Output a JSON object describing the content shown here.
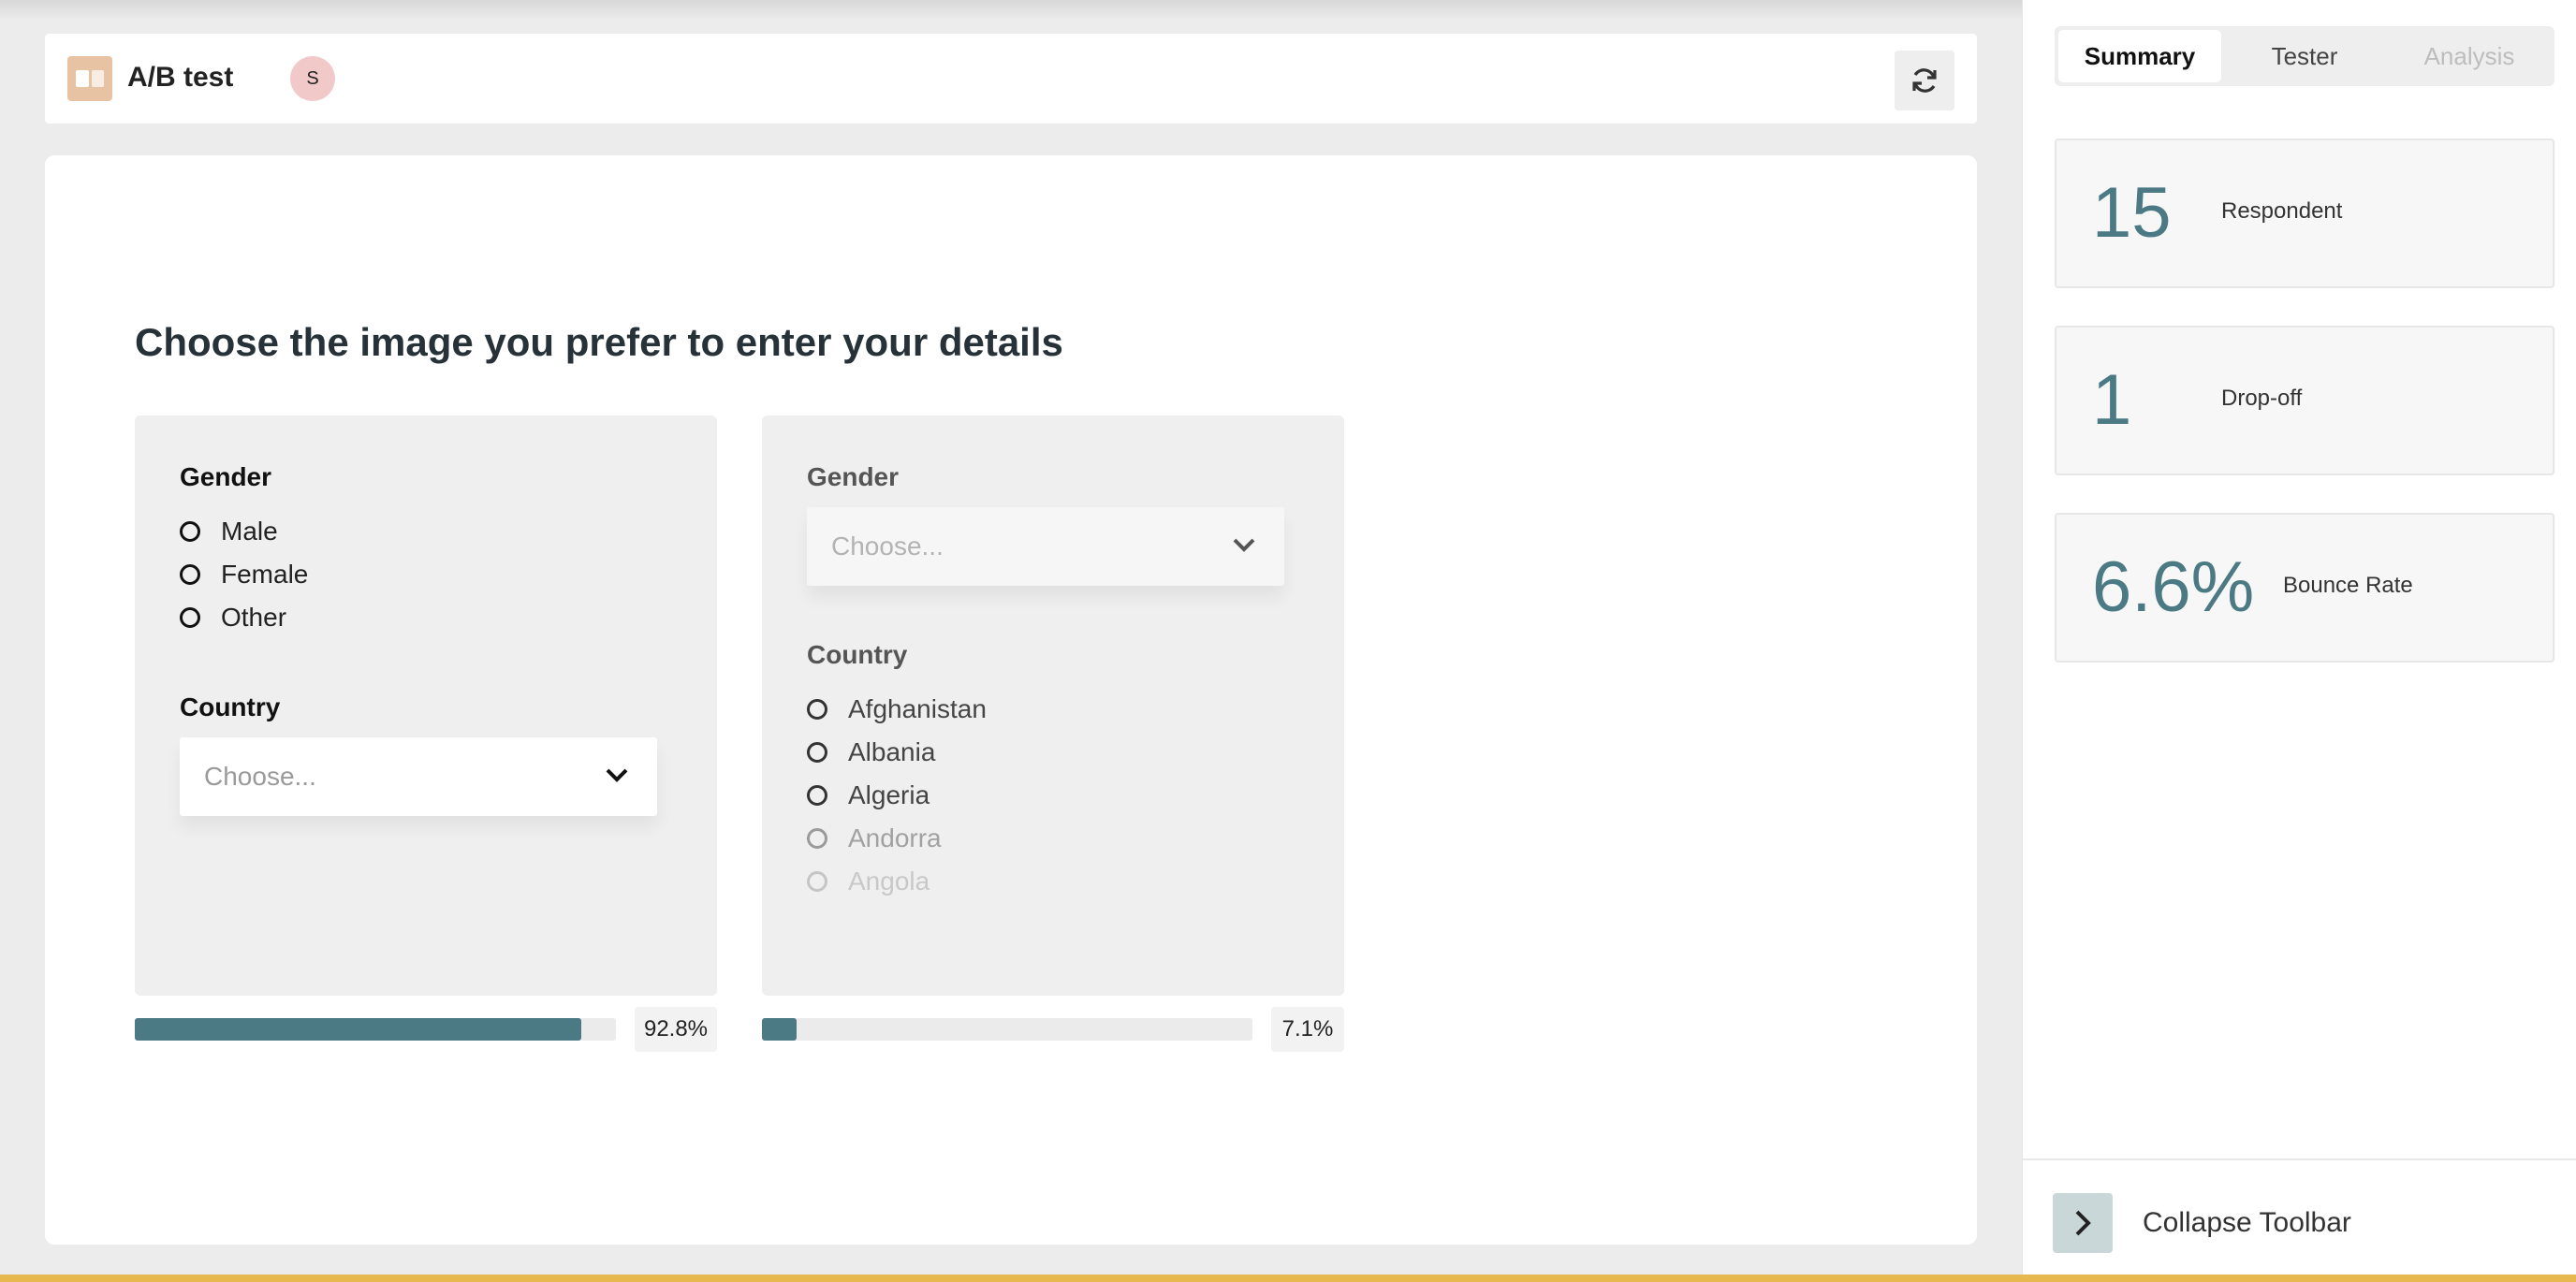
{
  "header": {
    "title": "A/B test",
    "avatar_initial": "S",
    "logo_icon": "split-view-icon",
    "refresh_icon": "refresh-icon"
  },
  "question": "Choose the image you prefer to enter your details",
  "variant_a": {
    "gender_label": "Gender",
    "gender_options": [
      "Male",
      "Female",
      "Other"
    ],
    "country_label": "Country",
    "country_placeholder": "Choose...",
    "result_fraction": 0.928,
    "result_label": "92.8%"
  },
  "variant_b": {
    "gender_label": "Gender",
    "gender_placeholder": "Choose...",
    "country_label": "Country",
    "country_options": [
      "Afghanistan",
      "Albania",
      "Algeria",
      "Andorra",
      "Angola"
    ],
    "result_fraction": 0.071,
    "result_label": "7.1%"
  },
  "sidebar": {
    "tabs": [
      "Summary",
      "Tester",
      "Analysis"
    ],
    "active_tab": "Summary",
    "stats": [
      {
        "value": "15",
        "label": "Respondent"
      },
      {
        "value": "1",
        "label": "Drop-off"
      },
      {
        "value": "6.6%",
        "label": "Bounce Rate"
      }
    ],
    "collapse_label": "Collapse Toolbar"
  },
  "colors": {
    "accent": "#4b7a84",
    "bottom_border": "#e6b84f",
    "logo_bg": "#e7c3a3",
    "avatar_bg": "#f2c9c9"
  }
}
